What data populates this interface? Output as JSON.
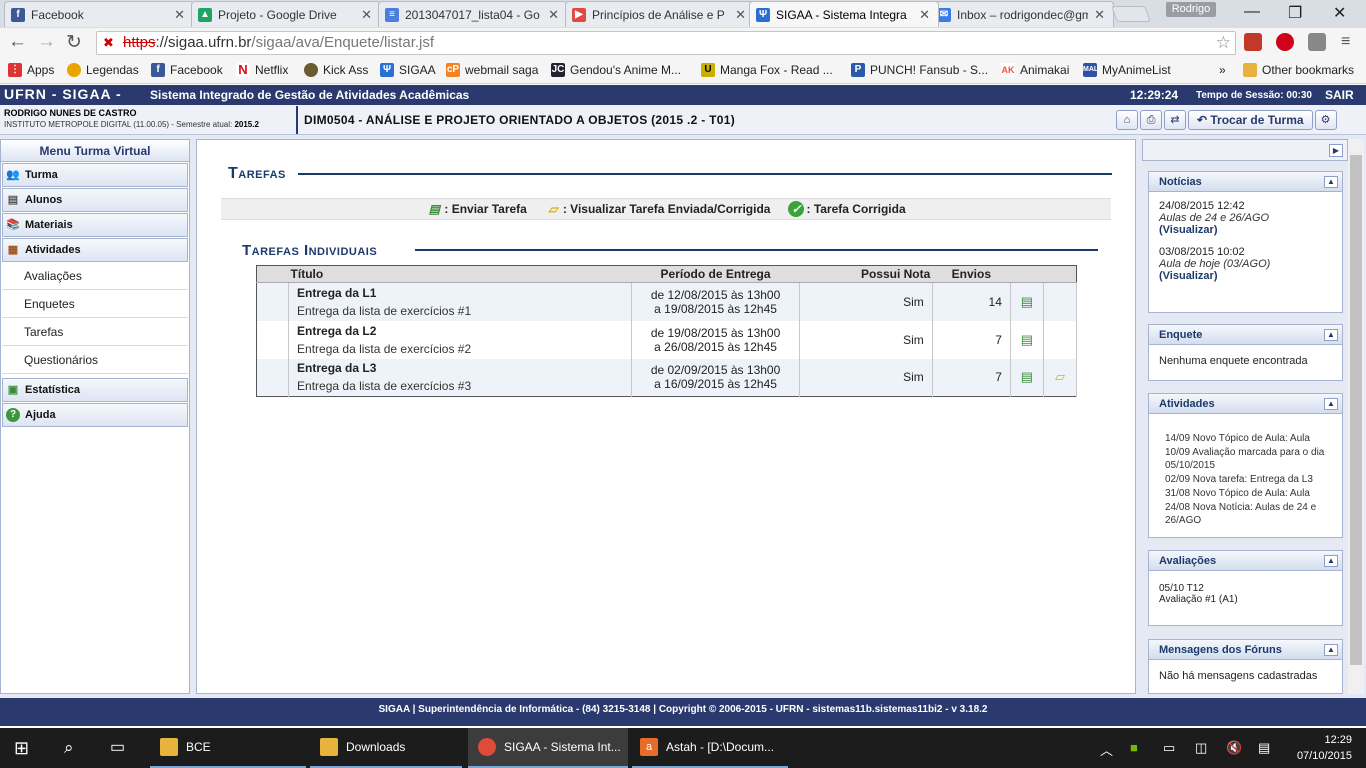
{
  "browser": {
    "tabs": [
      {
        "title": "Facebook",
        "fav": "f",
        "color": "#3b5998"
      },
      {
        "title": "Projeto - Google Drive",
        "fav": "▲",
        "color": "#1fa463"
      },
      {
        "title": "2013047017_lista04 - Go",
        "fav": "≡",
        "color": "#4a7fe0"
      },
      {
        "title": "Princípios de Análise e P",
        "fav": "▶",
        "color": "#e04a3f"
      },
      {
        "title": "SIGAA - Sistema Integra",
        "fav": "Ψ",
        "color": "#2a6fd6"
      },
      {
        "title": "Inbox – rodrigondec@gm",
        "fav": "✉",
        "color": "#3a7be8"
      }
    ],
    "profile": "Rodrigo",
    "url_scheme": "https",
    "url_rest": "://sigaa.ufrn.br",
    "url_path": "/sigaa/ava/Enquete/listar.jsf",
    "bookmarks": [
      "Apps",
      "Legendas",
      "Facebook",
      "Netflix",
      "Kick Ass",
      "SIGAA",
      "webmail saga",
      "Gendou's Anime M...",
      "Manga Fox - Read ...",
      "PUNCH! Fansub - S...",
      "Animakai",
      "MyAnimeList"
    ],
    "bookmarks_more": "»",
    "other_bookmarks": "Other bookmarks"
  },
  "header": {
    "brand": "UFRN - SIGAA -",
    "system": "Sistema Integrado de Gestão de Atividades Acadêmicas",
    "clock": "12:29:24",
    "session": "Tempo de Sessão: 00:30",
    "logout": "SAIR",
    "user_name": "RODRIGO NUNES DE CASTRO",
    "institute": "INSTITUTO METROPOLE DIGITAL (11.00.05) - Semestre atual:",
    "semester": "2015.2",
    "course": "DIM0504 - ANÁLISE E PROJETO ORIENTADO A OBJETOS (2015 .2 - T01)",
    "switch_class": "Trocar de Turma"
  },
  "menu": {
    "title": "Menu Turma Virtual",
    "items": {
      "turma": "Turma",
      "alunos": "Alunos",
      "materiais": "Materiais",
      "atividades": "Atividades",
      "estatistica": "Estatística",
      "ajuda": "Ajuda"
    },
    "sub": [
      "Avaliações",
      "Enquetes",
      "Tarefas",
      "Questionários"
    ]
  },
  "main": {
    "title": "Tarefas",
    "legend": {
      "enviar": ": Enviar Tarefa",
      "visualizar": ": Visualizar Tarefa Enviada/Corrigida",
      "corrigida": ": Tarefa Corrigida"
    },
    "subtitle": "Tarefas Individuais",
    "columns": {
      "titulo": "Título",
      "periodo": "Período de Entrega",
      "nota": "Possui Nota",
      "envios": "Envios"
    },
    "rows": [
      {
        "title": "Entrega da L1",
        "desc": "Entrega da lista de exercícios #1",
        "start": "de 12/08/2015 às 13h00",
        "end": "a 19/08/2015 às 12h45",
        "nota": "Sim",
        "envios": "14"
      },
      {
        "title": "Entrega da L2",
        "desc": "Entrega da lista de exercícios #2",
        "start": "de 19/08/2015 às 13h00",
        "end": "a 26/08/2015 às 12h45",
        "nota": "Sim",
        "envios": "7"
      },
      {
        "title": "Entrega da L3",
        "desc": "Entrega da lista de exercícios #3",
        "start": "de 02/09/2015 às 13h00",
        "end": "a 16/09/2015 às 12h45",
        "nota": "Sim",
        "envios": "7"
      }
    ]
  },
  "sidebar": {
    "noticias": {
      "title": "Notícias",
      "items": [
        {
          "date": "24/08/2015 12:42",
          "text": "Aulas de 24 e 26/AGO",
          "link": "(Visualizar)"
        },
        {
          "date": "03/08/2015 10:02",
          "text": "Aula de hoje (03/AGO)",
          "link": "(Visualizar)"
        }
      ]
    },
    "enquete": {
      "title": "Enquete",
      "text": "Nenhuma enquete encontrada"
    },
    "atividades": {
      "title": "Atividades",
      "items": [
        "14/09 Novo Tópico de Aula: Aula",
        "10/09 Avaliação marcada para o dia 05/10/2015",
        "02/09 Nova tarefa: Entrega da L3",
        "31/08 Novo Tópico de Aula: Aula",
        "24/08 Nova Notícia: Aulas de 24 e 26/AGO"
      ]
    },
    "avaliacoes": {
      "title": "Avaliações",
      "date": "05/10 T12",
      "name": "Avaliação #1 (A1)"
    },
    "foruns": {
      "title": "Mensagens dos Fóruns",
      "text": "Não há mensagens cadastradas"
    }
  },
  "footer": {
    "text": "SIGAA | Superintendência de Informática - (84) 3215-3148 | Copyright © 2006-2015 - UFRN - sistemas11b.sistemas11bi2 -",
    "version": "v 3.18.2"
  },
  "taskbar": {
    "items": [
      "BCE",
      "Downloads",
      "SIGAA - Sistema Int...",
      "Astah - [D:\\Docum..."
    ],
    "time": "12:29",
    "date": "07/10/2015"
  }
}
